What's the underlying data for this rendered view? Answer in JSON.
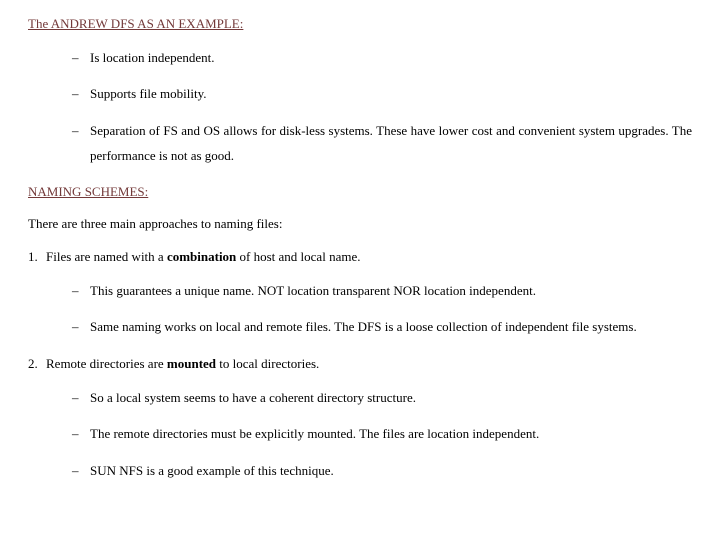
{
  "h1": "The ANDREW DFS AS AN EXAMPLE:",
  "andrew": {
    "b1": "Is location independent.",
    "b2": "Supports file mobility.",
    "b3": "Separation of FS and OS allows for disk-less systems. These have lower cost and convenient system upgrades. The performance is not as good."
  },
  "h2": "NAMING SCHEMES:",
  "intro": "There are three main approaches to naming files:",
  "scheme1": {
    "num": "1.",
    "pre": "Files are named with a ",
    "bold": "combination",
    "post": " of host and local name.",
    "b1": "This guarantees a unique name. NOT location transparent NOR location independent.",
    "b2": "Same naming works on local and remote files. The DFS is a loose collection of independent file systems."
  },
  "scheme2": {
    "num": "2.",
    "pre": "Remote directories are ",
    "bold": "mounted",
    "post": " to local directories.",
    "b1": "So a local system seems to have a coherent directory structure.",
    "b2": "The remote directories must be explicitly mounted. The files are location independent.",
    "b3": "SUN NFS is a good example of this technique."
  }
}
